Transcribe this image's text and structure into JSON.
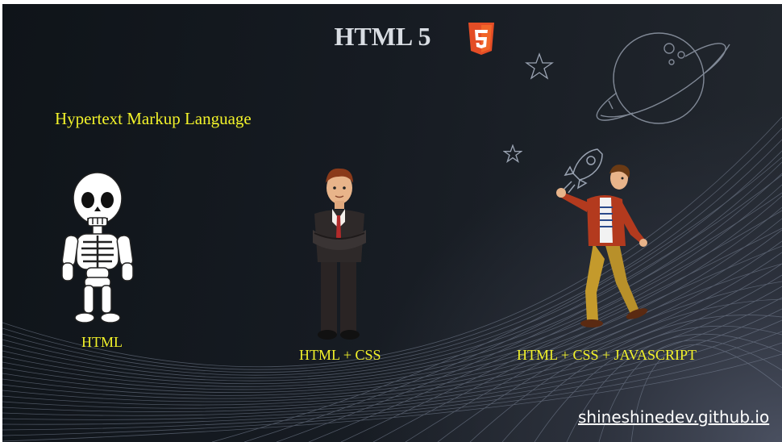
{
  "slide": {
    "title": "HTML 5",
    "badge_text": "5",
    "subtitle": "Hypertext Markup Language",
    "stages": [
      {
        "label": "HTML",
        "figure": "skeleton-figure"
      },
      {
        "label": "HTML + CSS",
        "figure": "suit-man-figure"
      },
      {
        "label": "HTML + CSS + JAVASCRIPT",
        "figure": "dancing-man-figure"
      }
    ],
    "footer_link": "shineshinedev.github.io"
  },
  "colors": {
    "background": "#161b22",
    "title": "#d9dde3",
    "accent_yellow": "#f2f22a",
    "html5_orange": "#e44d26"
  },
  "icons": [
    "html5-logo-icon",
    "planet-icon",
    "star-icon",
    "rocket-icon"
  ]
}
